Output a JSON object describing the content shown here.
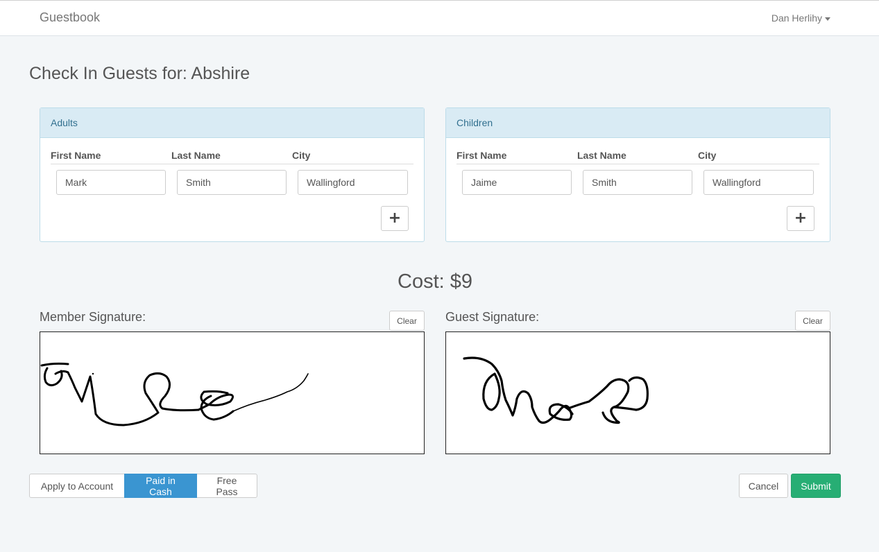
{
  "navbar": {
    "brand": "Guestbook",
    "user_name": "Dan Herlihy"
  },
  "page": {
    "title": "Check In Guests for: Abshire"
  },
  "adults": {
    "heading": "Adults",
    "columns": [
      "First Name",
      "Last Name",
      "City"
    ],
    "rows": [
      {
        "first_name": "Mark",
        "last_name": "Smith",
        "city": "Wallingford"
      }
    ],
    "add_icon": "plus-icon"
  },
  "children": {
    "heading": "Children",
    "columns": [
      "First Name",
      "Last Name",
      "City"
    ],
    "rows": [
      {
        "first_name": "Jaime",
        "last_name": "Smith",
        "city": "Wallingford"
      }
    ],
    "add_icon": "plus-icon"
  },
  "cost": {
    "text": "Cost: $9"
  },
  "signatures": {
    "member": {
      "label": "Member Signature:",
      "clear_label": "Clear"
    },
    "guest": {
      "label": "Guest Signature:",
      "clear_label": "Clear"
    }
  },
  "payment": {
    "options": [
      "Apply to Account",
      "Paid in Cash",
      "Free Pass"
    ],
    "selected": "Paid in Cash",
    "active_color": "#3a95d1"
  },
  "actions": {
    "cancel_label": "Cancel",
    "submit_label": "Submit",
    "submit_color": "#27ae74"
  }
}
